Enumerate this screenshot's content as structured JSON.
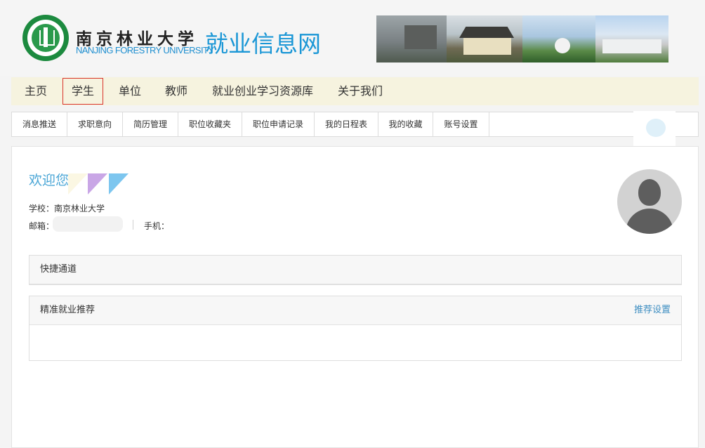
{
  "header": {
    "university_cn": "南京林业大学",
    "university_en": "NANJING FORESTRY UNIVERSITY",
    "site_name": "就业信息网"
  },
  "main_nav": {
    "items": [
      {
        "label": "主页"
      },
      {
        "label": "学生",
        "active": true
      },
      {
        "label": "单位"
      },
      {
        "label": "教师"
      },
      {
        "label": "就业创业学习资源库"
      },
      {
        "label": "关于我们"
      }
    ]
  },
  "sub_nav": {
    "tabs": [
      {
        "label": "消息推送"
      },
      {
        "label": "求职意向"
      },
      {
        "label": "简历管理"
      },
      {
        "label": "职位收藏夹"
      },
      {
        "label": "职位申请记录"
      },
      {
        "label": "我的日程表"
      },
      {
        "label": "我的收藏"
      },
      {
        "label": "账号设置"
      }
    ]
  },
  "profile": {
    "welcome": "欢迎您",
    "school": "学校：南京林业大学",
    "email_label": "邮箱：",
    "phone_label": "手机："
  },
  "quick_access": {
    "title": "快捷通道"
  },
  "recommend": {
    "title": "精准就业推荐",
    "settings_link": "推荐设置"
  },
  "colors": {
    "accent_blue": "#1b97d6",
    "active_border": "#d9332b",
    "nav_bg": "#f6f3df"
  }
}
